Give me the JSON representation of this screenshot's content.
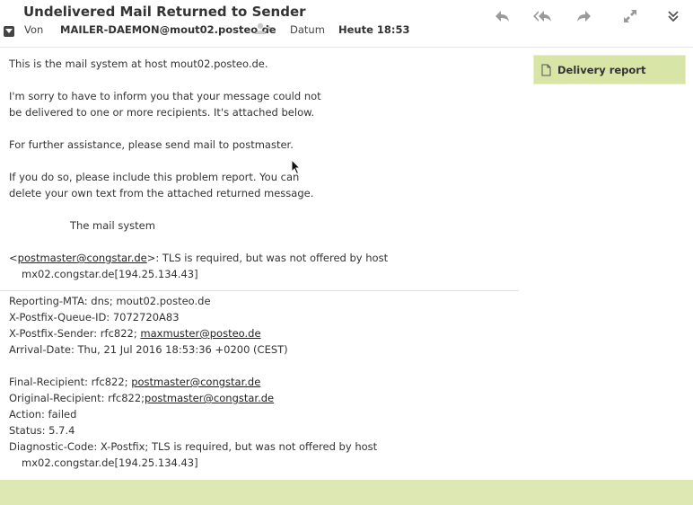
{
  "header": {
    "subject": "Undelivered Mail Returned to Sender",
    "from_label": "Von",
    "from_value": "MAILER-DAEMON@mout02.posteo.de",
    "date_label": "Datum",
    "date_value": "Heute 18:53"
  },
  "toolbar": {
    "icons": [
      "reply-icon",
      "reply-all-icon",
      "forward-icon",
      "expand-icon",
      "more-icon"
    ]
  },
  "body": {
    "lines": [
      "This is the mail system at host mout02.posteo.de.",
      "",
      "I'm sorry to have to inform you that your message could not",
      "be delivered to one or more recipients. It's attached below.",
      "",
      "For further assistance, please send mail to postmaster.",
      "",
      "If you do so, please include this problem report. You can",
      "delete your own text from the attached returned message.",
      "",
      "The mail system",
      ""
    ],
    "bounce_prefix": "<",
    "bounce_link": "postmaster@congstar.de",
    "bounce_suffix": ">: TLS is required, but was not offered by host",
    "bounce_host": "mx02.congstar.de[194.25.134.43]"
  },
  "report": {
    "reporting_mta": "Reporting-MTA: dns; mout02.posteo.de",
    "queue_id": "X-Postfix-Queue-ID: 7072720A83",
    "sender_prefix": "X-Postfix-Sender: rfc822; ",
    "sender_link": "maxmuster@posteo.de",
    "arrival_date": "Arrival-Date: Thu, 21 Jul 2016 18:53:36 +0200 (CEST)",
    "final_prefix": "Final-Recipient: rfc822; ",
    "final_link": "postmaster@congstar.de",
    "original_prefix": "Original-Recipient: rfc822;",
    "original_link": "postmaster@congstar.de",
    "action": "Action: failed",
    "status": "Status: 5.7.4",
    "diagnostic": "Diagnostic-Code: X-Postfix; TLS is required, but was not offered by host",
    "diagnostic_host": "mx02.congstar.de[194.25.134.43]"
  },
  "attachment": {
    "label": "Delivery report",
    "icon": "document-icon"
  },
  "colors": {
    "attachment_bg": "#d7e6a6",
    "bottom_bar": "#dde8b2",
    "text": "#333333"
  }
}
